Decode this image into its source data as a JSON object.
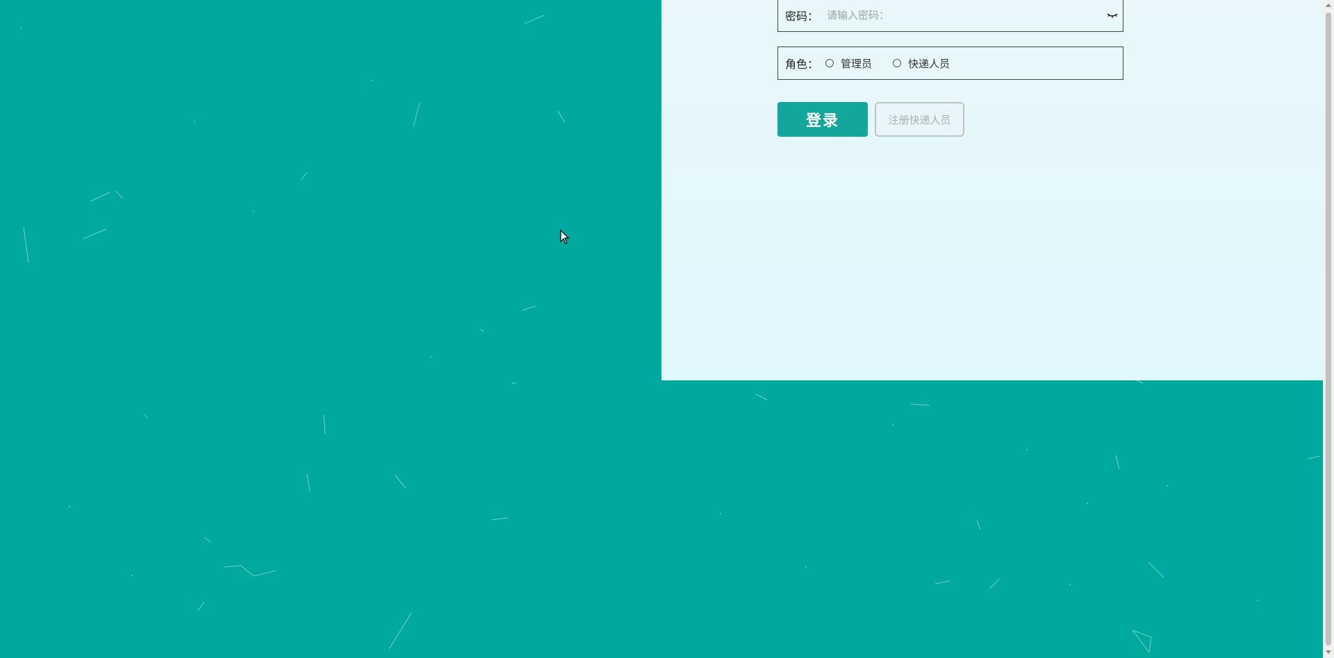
{
  "login_form": {
    "password_label": "密码：",
    "password_placeholder": "请输入密码：",
    "role_label": "角色：",
    "role_options": [
      "管理员",
      "快递人员"
    ],
    "login_button": "登录",
    "register_button": "注册快递人员"
  },
  "colors": {
    "background": "#01a89d",
    "panel": "#e6f8fc",
    "primary": "#12a69c"
  },
  "icons": {
    "password_toggle": "eye-closed-icon",
    "cursor": "mouse-cursor-icon"
  }
}
